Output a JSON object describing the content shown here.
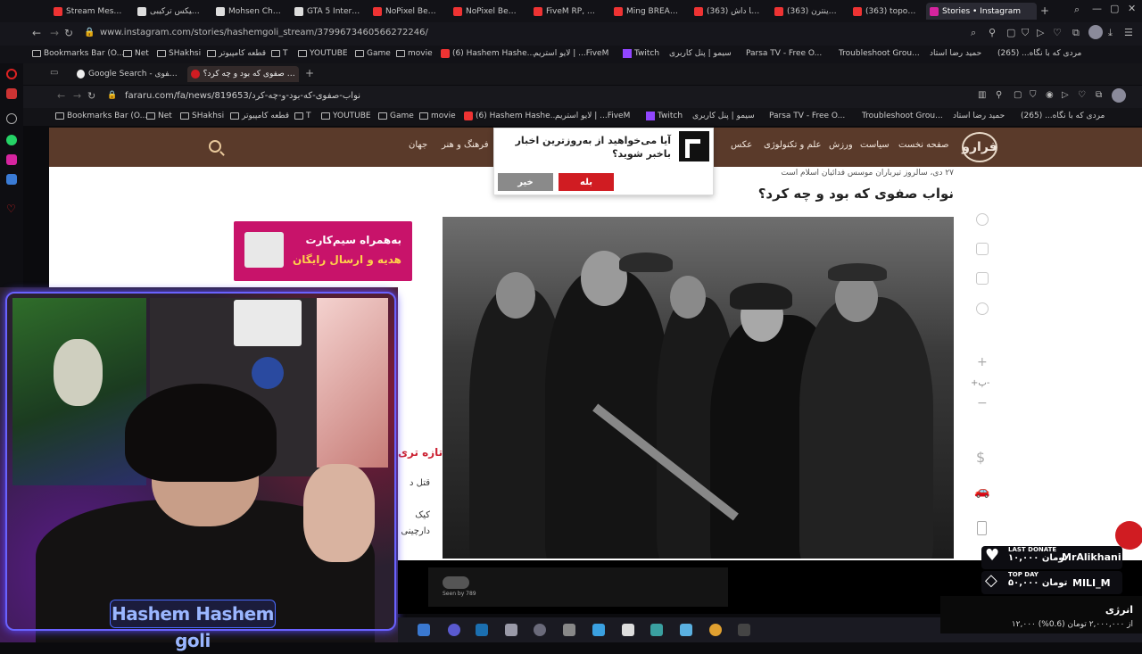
{
  "outer_browser": {
    "tabs": [
      {
        "label": "Stream Mester D"
      },
      {
        "label": "ریمیکس ترکیبی"
      },
      {
        "label": "Mohsen Chavos"
      },
      {
        "label": "GTA 5 Interactiv"
      },
      {
        "label": "NoPixel Best JU"
      },
      {
        "label": "NoPixel Best JU"
      },
      {
        "label": "FiveM RP, Simp"
      },
      {
        "label": "Ming BREAKING"
      },
      {
        "label": "لایو با داش (363)"
      },
      {
        "label": "ایران اینترن (363)"
      },
      {
        "label": "(363) topoghtin"
      },
      {
        "label": "Stories • Instagram"
      }
    ],
    "url": "www.instagram.com/stories/hashemgoli_stream/3799673460566272246/",
    "bookmarks": [
      "Bookmarks Bar (O...",
      "Net",
      "SHakhsi",
      "قطعه کامپیوتر",
      "T",
      "YOUTUBE",
      "Game",
      "movie",
      "(6) Hashem Hashe...",
      "لایو استریم | ...FiveM",
      "Twitch",
      "سیمو | پنل کاربری",
      "Parsa TV - Free O...",
      "Troubleshoot Grou...",
      "حمید رضا استاد",
      "مردی که با نگاه... (265)"
    ]
  },
  "inner_browser": {
    "tabs": [
      {
        "label": "Google Search - نواب صفوی"
      },
      {
        "label": "نواب صفوی که بود و چه کرد؟"
      }
    ],
    "url": "fararu.com/fa/news/819653/نواب-صفوی-که-بود-و-چه-کرد",
    "bookmarks": [
      "Bookmarks Bar (O...",
      "Net",
      "SHakhsi",
      "قطعه کامپیوتر",
      "T",
      "YOUTUBE",
      "Game",
      "movie",
      "(6) Hashem Hashe...",
      "لایو استریم | ...FiveM",
      "Twitch",
      "سیمو | پنل کاربری",
      "Parsa TV - Free O...",
      "Troubleshoot Grou...",
      "حمید رضا استاد",
      "مردی که با نگاه... (265)"
    ]
  },
  "site": {
    "logo": "فرارو",
    "nav": [
      "صفحه نخست",
      "سیاست",
      "ورزش",
      "علم و تکنولوژی",
      "عکس",
      "فرهنگ و هنر",
      "جهان"
    ],
    "date_line": "۲۷ دی، سالروز تیرباران موسس فدائیان اسلام است",
    "headline": "نواب صفوی که بود و چه کرد؟",
    "ad_line1": "به‌همراه سیم‌کارت",
    "ad_line2": "هدیه و ارسال رایگان",
    "trending_title": "تازه تری",
    "trending": [
      "قتل د",
      "کیک",
      "دارچینی"
    ],
    "font_label": "+پ-"
  },
  "popup": {
    "question": "آیا می‌خواهید از به‌روزترین اخبار باخبر شوید؟",
    "yes": "بله",
    "no": "خیر"
  },
  "webcam": {
    "name": "Hashem Hashem goli"
  },
  "story": {
    "seen_by": "Seen by 789"
  },
  "donate": {
    "last_label": "LAST DONATE",
    "last_amount": "۱۰,۰۰۰ تومان",
    "last_name": "MrAlikhani",
    "top_label": "TOP DAY",
    "top_amount": "۵۰,۰۰۰ تومان",
    "top_name": "MILI_M",
    "energy_title": "انرژی",
    "energy_sub": "۱۲,۰۰۰ از ۲,۰۰۰,۰۰۰ تومان (0.6%)"
  },
  "colors": {
    "site_nav": "#5a3a2a",
    "accent_red": "#d01c22",
    "ad_bg": "#c8136a",
    "cam_frame": "#6a62ff"
  }
}
